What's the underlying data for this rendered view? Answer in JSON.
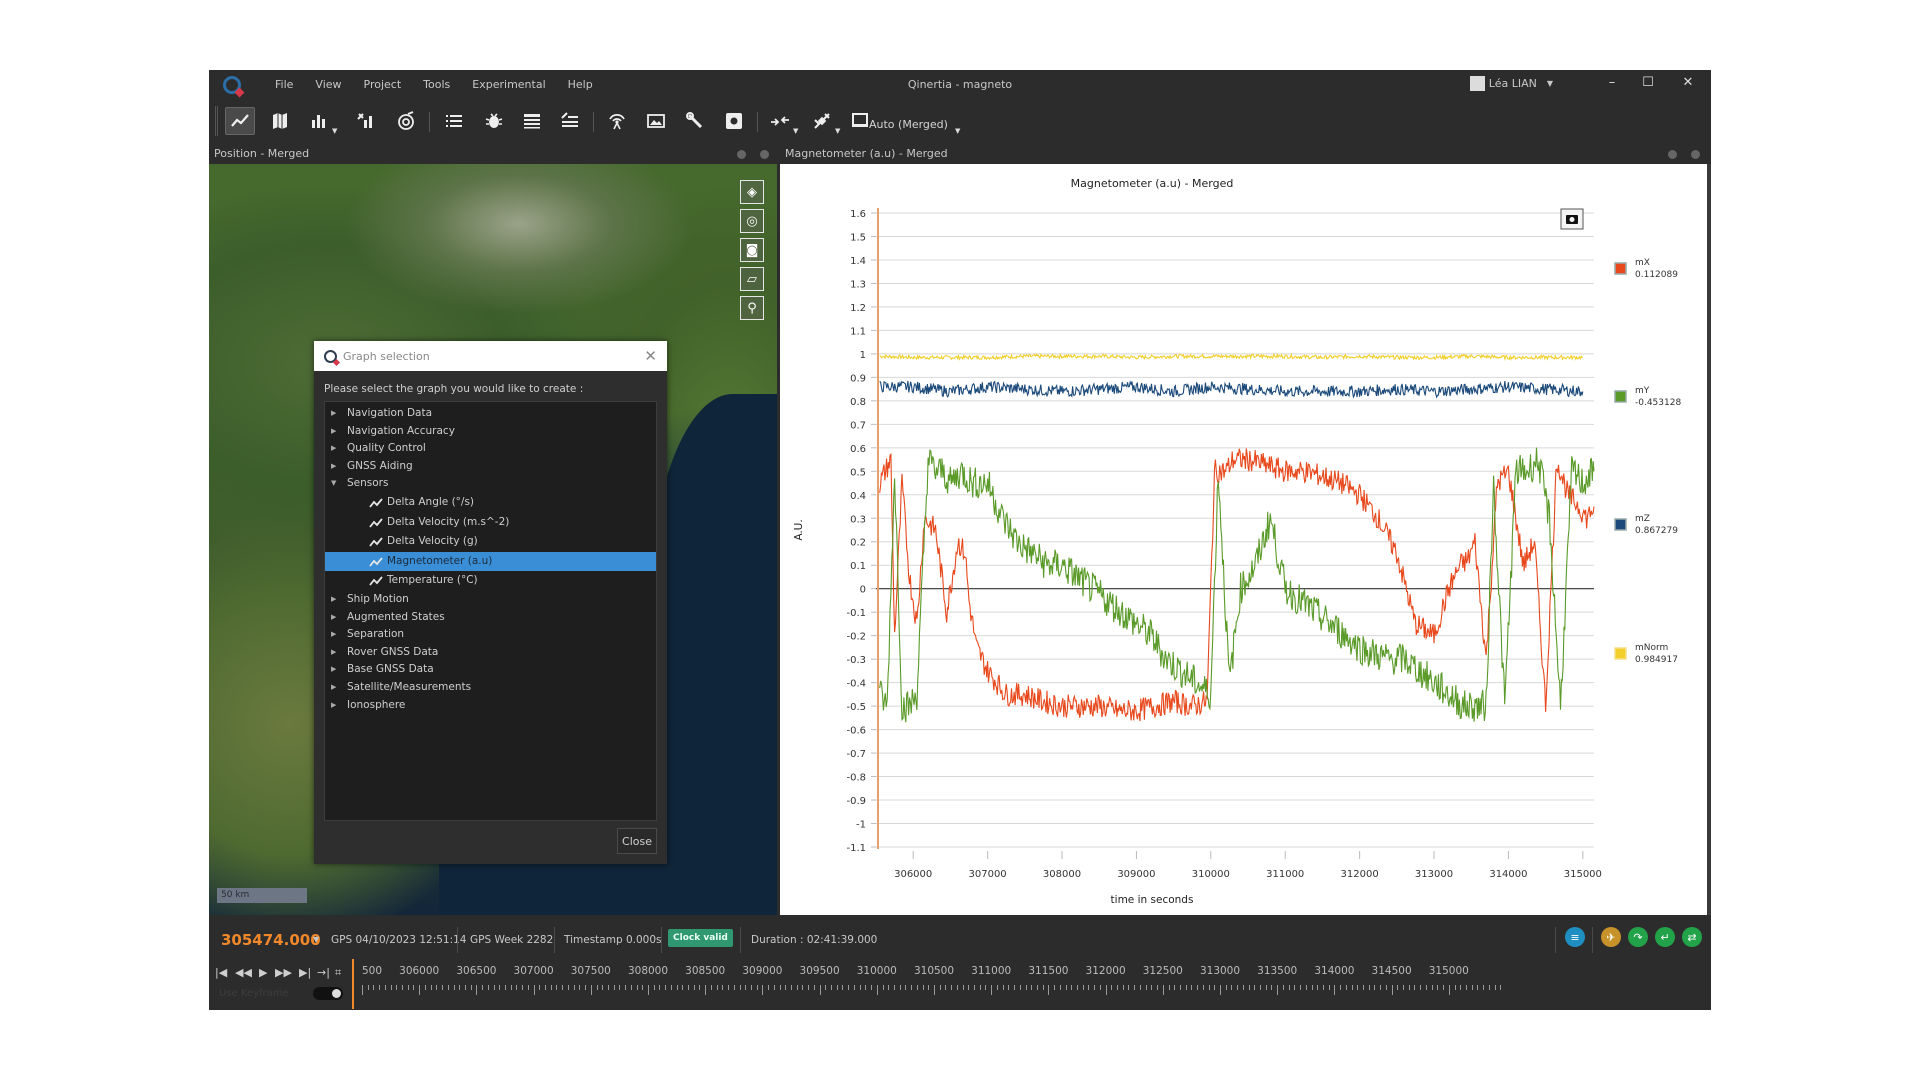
{
  "window": {
    "title": "Qinertia - magneto",
    "menu": [
      "File",
      "View",
      "Project",
      "Tools",
      "Experimental",
      "Help"
    ],
    "user": "Léa LIAN",
    "controls": {
      "minimize": "–",
      "maximize": "☐",
      "close": "✕"
    }
  },
  "toolbar": {
    "icons": [
      "graph-icon",
      "map-icon",
      "bar-chart-icon",
      "satellite-bars-icon",
      "satellite-radar-icon",
      "list-icon",
      "bug-icon",
      "table-icon",
      "satellite-table-icon",
      "antenna-icon",
      "image-icon",
      "wrench-icon",
      "settings-box-icon",
      "merge-arrows-icon",
      "satellite-tool-icon",
      "monitor-icon"
    ],
    "mode_label": "Auto (Merged)"
  },
  "panels": {
    "left_title": "Position - Merged",
    "right_title": "Magnetometer (a.u) - Merged"
  },
  "map": {
    "tools": [
      "layers-icon",
      "locate-icon",
      "camera-icon",
      "ruler-icon",
      "pin-icon"
    ],
    "scale_label": "50 km"
  },
  "dialog": {
    "title": "Graph selection",
    "prompt": "Please select the graph you would like to create :",
    "close_label": "Close",
    "tree": [
      {
        "label": "Navigation Data",
        "expanded": false
      },
      {
        "label": "Navigation Accuracy",
        "expanded": false
      },
      {
        "label": "Quality Control",
        "expanded": false
      },
      {
        "label": "GNSS Aiding",
        "expanded": false
      },
      {
        "label": "Sensors",
        "expanded": true,
        "children": [
          {
            "label": "Delta Angle (°/s)",
            "selected": false
          },
          {
            "label": "Delta Velocity (m.s^-2)",
            "selected": false
          },
          {
            "label": "Delta Velocity (g)",
            "selected": false
          },
          {
            "label": "Magnetometer (a.u)",
            "selected": true
          },
          {
            "label": "Temperature (°C)",
            "selected": false
          }
        ]
      },
      {
        "label": "Ship Motion",
        "expanded": false
      },
      {
        "label": "Augmented States",
        "expanded": false
      },
      {
        "label": "Separation",
        "expanded": false
      },
      {
        "label": "Rover GNSS Data",
        "expanded": false
      },
      {
        "label": "Base GNSS Data",
        "expanded": false
      },
      {
        "label": "Satellite/Measurements",
        "expanded": false
      },
      {
        "label": "Ionosphere",
        "expanded": false
      }
    ]
  },
  "chart_data": {
    "type": "line",
    "title": "Magnetometer (a.u) - Merged",
    "xlabel": "time in seconds",
    "ylabel": "A.U.",
    "xlim": [
      305500,
      315150
    ],
    "ylim": [
      -1.1,
      1.6
    ],
    "x_ticks": [
      306000,
      307000,
      308000,
      309000,
      310000,
      311000,
      312000,
      313000,
      314000,
      315000
    ],
    "y_ticks": [
      1.6,
      1.5,
      1.4,
      1.3,
      1.2,
      1.1,
      1,
      0.9,
      0.8,
      0.7,
      0.6,
      0.5,
      0.4,
      0.3,
      0.2,
      0.1,
      0,
      -0.1,
      -0.2,
      -0.3,
      -0.4,
      -0.5,
      -0.6,
      -0.7,
      -0.8,
      -0.9,
      -1,
      -1.1
    ],
    "grid": true,
    "legend_position": "right",
    "cursor_x": 305474,
    "series": [
      {
        "name": "mX",
        "value": "0.112089",
        "color": "#e8481c",
        "x": [
          305550,
          305700,
          305750,
          305850,
          305950,
          306050,
          306150,
          306300,
          306450,
          306600,
          306700,
          306750,
          306850,
          307000,
          307250,
          307500,
          307750,
          308000,
          308250,
          308500,
          308750,
          309000,
          309250,
          309500,
          309750,
          309950,
          310050,
          310200,
          310300,
          310500,
          310800,
          311000,
          311250,
          311500,
          311750,
          312000,
          312250,
          312500,
          312750,
          313000,
          313200,
          313350,
          313450,
          313550,
          313700,
          313850,
          314000,
          314200,
          314350,
          314500,
          314650,
          314800,
          314950,
          315050,
          315150
        ],
        "y": [
          0.45,
          0.55,
          -0.2,
          0.45,
          0.05,
          -0.15,
          0.3,
          0.25,
          -0.1,
          0.2,
          0.15,
          -0.05,
          -0.25,
          -0.35,
          -0.45,
          -0.45,
          -0.48,
          -0.5,
          -0.5,
          -0.5,
          -0.52,
          -0.52,
          -0.5,
          -0.48,
          -0.5,
          -0.48,
          0.5,
          0.5,
          0.55,
          0.55,
          0.52,
          0.5,
          0.5,
          0.48,
          0.45,
          0.4,
          0.3,
          0.15,
          -0.15,
          -0.2,
          0.0,
          0.1,
          0.12,
          0.2,
          -0.3,
          0.45,
          0.5,
          0.1,
          0.2,
          -0.5,
          0.55,
          0.4,
          0.35,
          0.3,
          0.35
        ]
      },
      {
        "name": "mY",
        "value": "-0.453128",
        "color": "#5a9a28",
        "x": [
          305550,
          305650,
          305750,
          305850,
          305950,
          306050,
          306200,
          306300,
          306400,
          306500,
          306650,
          306800,
          307000,
          307200,
          307400,
          307600,
          307800,
          308000,
          308200,
          308400,
          308600,
          308800,
          309000,
          309200,
          309400,
          309600,
          309800,
          310000,
          310100,
          310250,
          310400,
          310600,
          310800,
          311000,
          311200,
          311400,
          311600,
          311800,
          312000,
          312200,
          312400,
          312600,
          312800,
          313000,
          313200,
          313400,
          313550,
          313700,
          313800,
          313950,
          314100,
          314250,
          314400,
          314550,
          314700,
          314850,
          315000,
          315150
        ],
        "y": [
          -0.45,
          -0.5,
          0.5,
          -0.5,
          -0.5,
          -0.45,
          0.55,
          0.5,
          0.5,
          0.45,
          0.5,
          0.45,
          0.45,
          0.3,
          0.2,
          0.15,
          0.1,
          0.1,
          0.05,
          0.0,
          -0.05,
          -0.1,
          -0.15,
          -0.2,
          -0.3,
          -0.35,
          -0.4,
          -0.45,
          0.5,
          -0.4,
          0.0,
          0.1,
          0.3,
          0.0,
          -0.05,
          -0.1,
          -0.15,
          -0.2,
          -0.25,
          -0.28,
          -0.3,
          -0.3,
          -0.35,
          -0.4,
          -0.45,
          -0.5,
          -0.5,
          -0.5,
          0.45,
          -0.5,
          0.5,
          0.5,
          0.55,
          0.3,
          -0.5,
          0.5,
          0.45,
          0.5
        ]
      },
      {
        "name": "mZ",
        "value": "0.867279",
        "color": "#1c4a7a",
        "x": [
          305550,
          306000,
          306500,
          307000,
          307500,
          308000,
          308500,
          309000,
          309500,
          310000,
          310500,
          311000,
          311500,
          312000,
          312500,
          313000,
          313500,
          314000,
          314500,
          315000
        ],
        "y": [
          0.86,
          0.86,
          0.84,
          0.86,
          0.85,
          0.84,
          0.85,
          0.86,
          0.84,
          0.86,
          0.85,
          0.84,
          0.84,
          0.84,
          0.85,
          0.84,
          0.85,
          0.86,
          0.85,
          0.84
        ]
      },
      {
        "name": "mNorm",
        "value": "0.984917",
        "color": "#f2cf2a",
        "x": [
          305550,
          306000,
          306500,
          307000,
          307500,
          308000,
          308500,
          309000,
          309500,
          310000,
          310500,
          311000,
          311500,
          312000,
          312500,
          313000,
          313500,
          314000,
          314500,
          315000
        ],
        "y": [
          0.99,
          0.985,
          0.985,
          0.985,
          0.99,
          0.99,
          0.99,
          0.985,
          0.99,
          0.99,
          0.99,
          0.99,
          0.985,
          0.99,
          0.985,
          0.985,
          0.99,
          0.985,
          0.985,
          0.985
        ]
      }
    ]
  },
  "status": {
    "time": "305474.000",
    "gps_date": "GPS 04/10/2023 12:51:14",
    "gps_week": "GPS Week 2282",
    "timestamp": "Timestamp 0.000s",
    "clock_badge": "Clock valid",
    "duration": "Duration : 02:41:39.000",
    "hidden_toggle_label": "Use Keyframe",
    "timeline_labels": [
      "500",
      "306000",
      "306500",
      "307000",
      "307500",
      "308000",
      "308500",
      "309000",
      "309500",
      "310000",
      "310500",
      "311000",
      "311500",
      "312000",
      "312500",
      "313000",
      "313500",
      "314000",
      "314500",
      "315000"
    ],
    "icons": [
      {
        "name": "list-circle-icon",
        "color": "#1f8fc2"
      },
      {
        "name": "satellite-circle-icon",
        "color": "#c7922a"
      },
      {
        "name": "forward-circle-icon",
        "color": "#22a34a"
      },
      {
        "name": "return-circle-icon",
        "color": "#22a34a"
      },
      {
        "name": "sync-circle-icon",
        "color": "#22a34a"
      }
    ]
  },
  "playback": [
    "skip-start-icon",
    "rewind-icon",
    "play-icon",
    "fast-forward-icon",
    "skip-end-icon",
    "jump-to-icon",
    "crop-icon"
  ]
}
